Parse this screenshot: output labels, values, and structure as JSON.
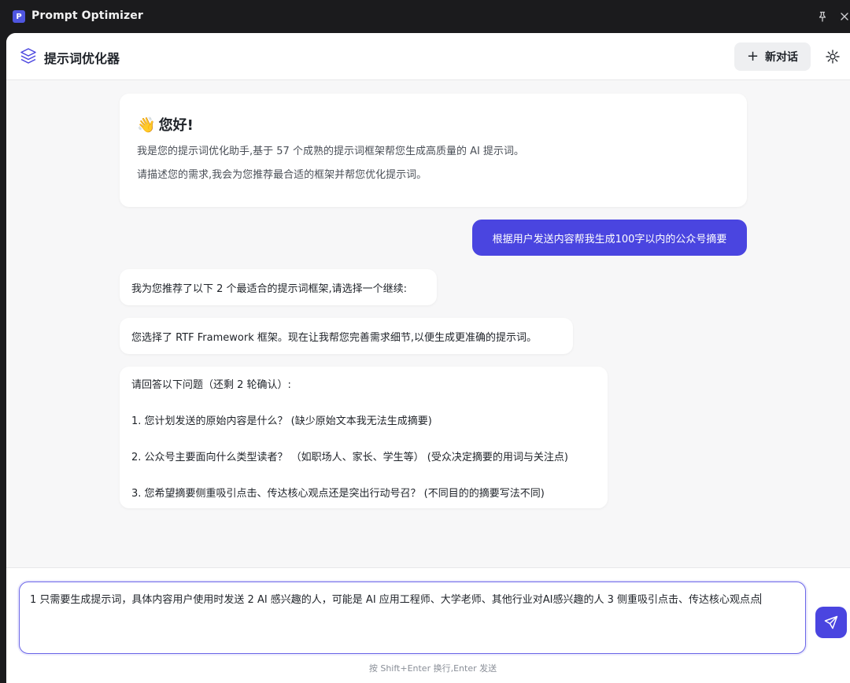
{
  "titlebar": {
    "app_icon_letter": "P",
    "title": "Prompt Optimizer"
  },
  "header": {
    "title": "提示词优化器",
    "new_chat_label": "新对话",
    "icons": [
      "layers-logo-icon",
      "plus-icon",
      "sun-theme-icon",
      "pin-icon",
      "close-icon"
    ]
  },
  "messages": {
    "welcome": {
      "emoji": "👋",
      "title": "您好!",
      "line1": "我是您的提示词优化助手,基于 57 个成熟的提示词框架帮您生成高质量的 AI 提示词。",
      "line2": "请描述您的需求,我会为您推荐最合适的框架并帮您优化提示词。"
    },
    "user1": "根据用户发送内容帮我生成100字以内的公众号摘要",
    "bot1": "我为您推荐了以下 2 个最适合的提示词框架,请选择一个继续:",
    "bot2": "您选择了 RTF Framework 框架。现在让我帮您完善需求细节,以便生成更准确的提示词。",
    "bot3": {
      "intro": "请回答以下问题（还剩 2 轮确认）:",
      "q1": "1. 您计划发送的原始内容是什么？ (缺少原始文本我无法生成摘要)",
      "q2": "2. 公众号主要面向什么类型读者？ （如职场人、家长、学生等） (受众决定摘要的用词与关注点)",
      "q3": "3. 您希望摘要侧重吸引点击、传达核心观点还是突出行动号召？ (不同目的的摘要写法不同)"
    }
  },
  "composer": {
    "value": "1 只需要生成提示词，具体内容用户使用时发送  2  AI 感兴趣的人，可能是 AI 应用工程师、大学老师、其他行业对AI感兴趣的人  3 侧重吸引点击、传达核心观点",
    "hint": "按 Shift+Enter 换行,Enter 发送"
  },
  "colors": {
    "accent": "#4a45e0",
    "background": "#f7f7f8",
    "titlebar": "#1b1b1d"
  }
}
